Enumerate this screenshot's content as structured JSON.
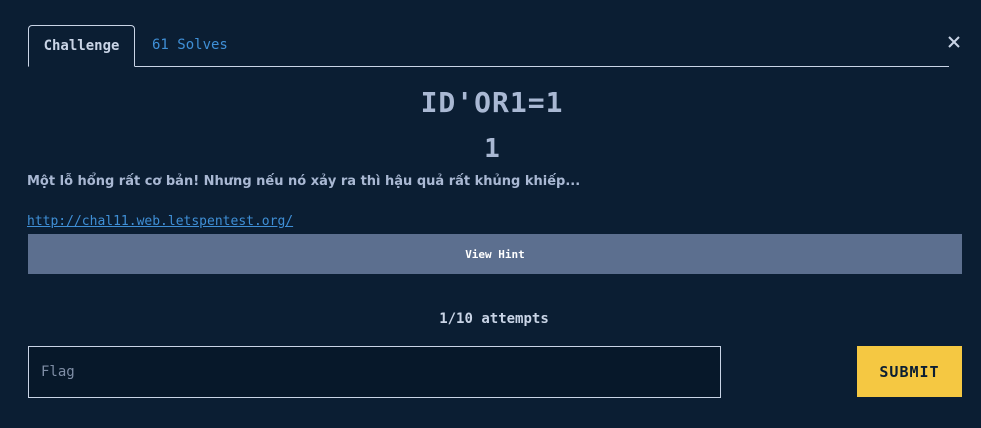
{
  "tabs": {
    "challenge": "Challenge",
    "solves": "61 Solves"
  },
  "close_icon": "close-icon",
  "challenge": {
    "title": "ID'OR1=1",
    "points": "1",
    "description": "Một lỗ hổng rất cơ bản! Nhưng nếu nó xảy ra thì hậu quả rất khủng khiếp...",
    "link": "http://chal11.web.letspentest.org/"
  },
  "hint": {
    "label": "View Hint"
  },
  "attempts": "1/10 attempts",
  "flag": {
    "placeholder": "Flag",
    "value": ""
  },
  "submit": {
    "label": "SUBMIT"
  },
  "colors": {
    "background": "#0b1e33",
    "link": "#3f8fd6",
    "hint_bg": "#5c6f8f",
    "submit_bg": "#f5c842"
  }
}
